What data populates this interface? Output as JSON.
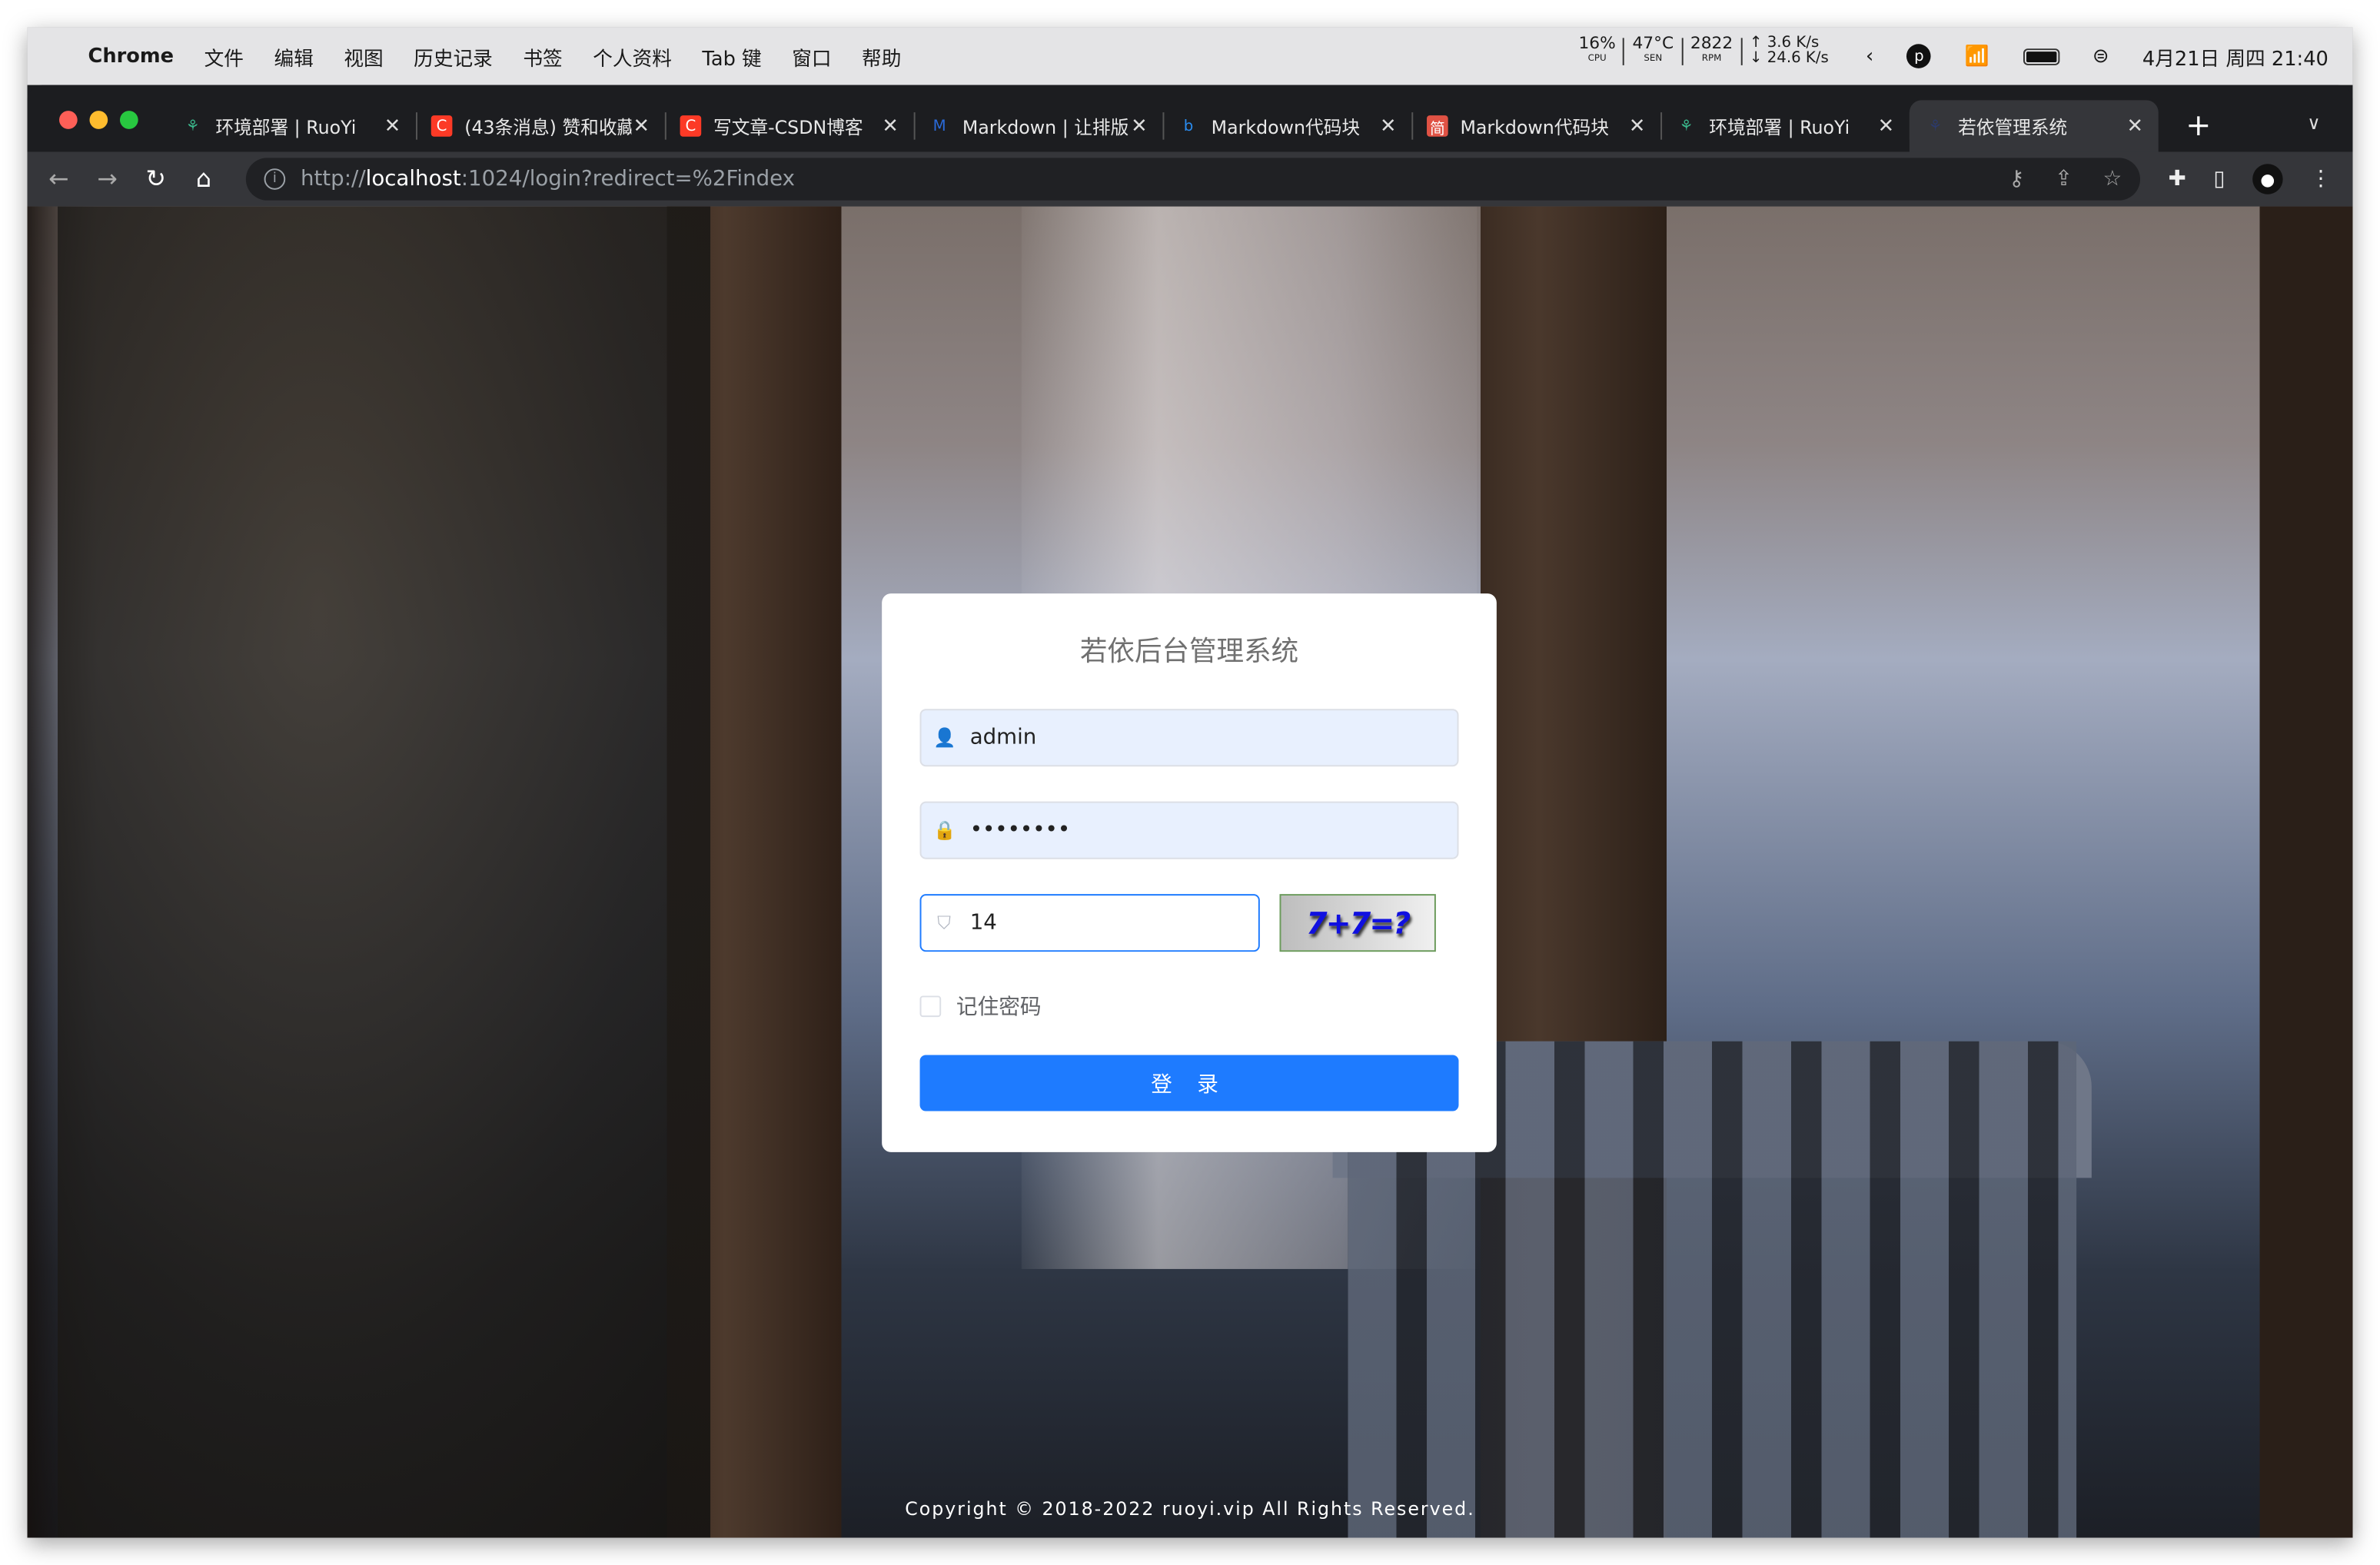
{
  "menubar": {
    "app": "Chrome",
    "items": [
      "文件",
      "编辑",
      "视图",
      "历史记录",
      "书签",
      "个人资料",
      "Tab 键",
      "窗口",
      "帮助"
    ],
    "stats": [
      {
        "value": "16%",
        "label": "CPU"
      },
      {
        "value": "47°C",
        "label": "SEN"
      },
      {
        "value": "2822",
        "label": "RPM"
      }
    ],
    "net_up": "↑ 3.6 K/s",
    "net_down": "↓ 24.6 K/s",
    "profile_letter": "p",
    "datetime": "4月21日 周四  21:40"
  },
  "tabs": [
    {
      "title": "环境部署 | RuoYi",
      "icon": "ruoyi-leaf",
      "color": "#3ab58a"
    },
    {
      "title": "(43条消息) 赞和收藏",
      "icon": "csdn-c",
      "color": "#fc3a26"
    },
    {
      "title": "写文章-CSDN博客",
      "icon": "csdn-c",
      "color": "#fc3a26"
    },
    {
      "title": "Markdown | 让排版",
      "icon": "markdown-m",
      "color": "#2a6ad8"
    },
    {
      "title": "Markdown代码块",
      "icon": "bing-b",
      "color": "#2a8cf0"
    },
    {
      "title": "Markdown代码块",
      "icon": "jianshu",
      "color": "#e05244"
    },
    {
      "title": "环境部署 | RuoYi",
      "icon": "ruoyi-leaf",
      "color": "#3ab58a"
    },
    {
      "title": "若依管理系统",
      "icon": "ruoyi-leaf",
      "color": "#2c3a6a",
      "active": true
    }
  ],
  "address": {
    "scheme": "http://",
    "host": "localhost",
    "rest": ":1024/login?redirect=%2Findex"
  },
  "login": {
    "title": "若依后台管理系统",
    "username": "admin",
    "password": "••••••••",
    "code": "14",
    "captcha": "7+7=?",
    "remember": "记住密码",
    "submit": "登 录",
    "accent": "#1e7bff"
  },
  "footer": "Copyright © 2018-2022 ruoyi.vip All Rights Reserved."
}
